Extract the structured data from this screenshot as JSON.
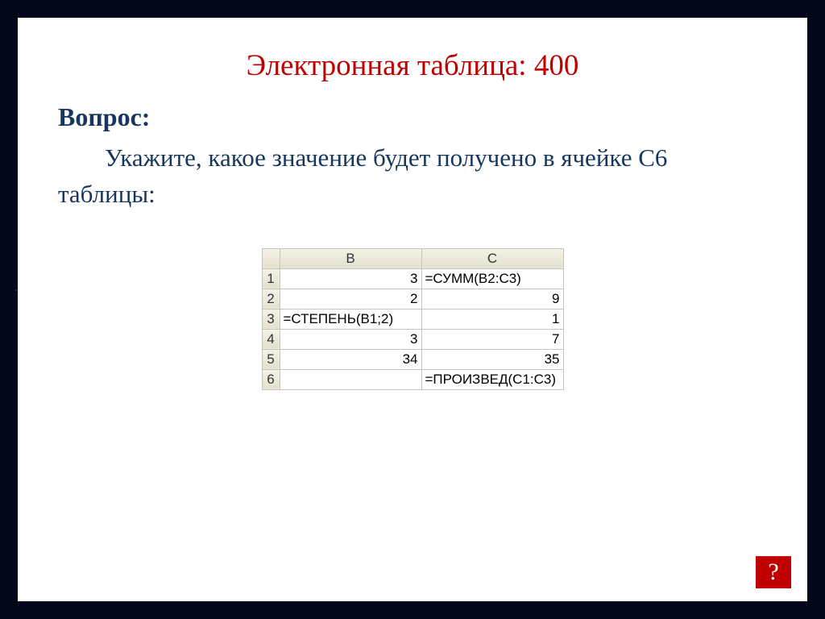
{
  "slide": {
    "title": "Электронная таблица: 400",
    "question_label": "Вопрос:",
    "question_text": "Укажите, какое значение будет получено в ячейке С6 таблицы:"
  },
  "sheet": {
    "columns": [
      "B",
      "C"
    ],
    "rows": [
      {
        "n": "1",
        "b": "3",
        "c": "=СУММ(B2:C3)",
        "b_align": "right",
        "c_align": "left"
      },
      {
        "n": "2",
        "b": "2",
        "c": "9",
        "b_align": "right",
        "c_align": "right"
      },
      {
        "n": "3",
        "b": "=СТЕПЕНЬ(B1;2)",
        "c": "1",
        "b_align": "left",
        "c_align": "right"
      },
      {
        "n": "4",
        "b": "3",
        "c": "7",
        "b_align": "right",
        "c_align": "right"
      },
      {
        "n": "5",
        "b": "34",
        "c": "35",
        "b_align": "right",
        "c_align": "right"
      },
      {
        "n": "6",
        "b": "",
        "c": "=ПРОИЗВЕД(C1:C3)",
        "b_align": "right",
        "c_align": "left"
      }
    ]
  },
  "help": {
    "label": "?"
  }
}
